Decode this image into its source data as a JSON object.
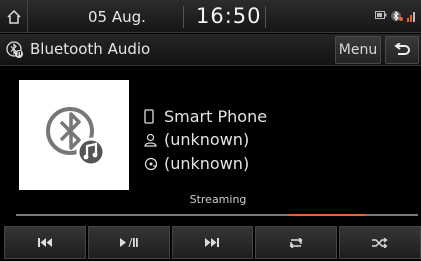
{
  "status": {
    "date": "05 Aug.",
    "time": "16:50",
    "icons": [
      "home-icon",
      "battery-icon",
      "bluetooth-status-icon",
      "signal-icon"
    ]
  },
  "titlebar": {
    "title": "Bluetooth Audio",
    "menu_label": "Menu",
    "back_icon": "back-icon"
  },
  "track": {
    "device": "Smart Phone",
    "artist": "(unknown)",
    "album": "(unknown)",
    "state": "Streaming"
  },
  "progress": {
    "bar_color": "#7a7a7a",
    "marker_color": "#e7642e",
    "marker_start": 0.68,
    "marker_end": 0.87
  },
  "controls": [
    "previous-icon",
    "play-pause-icon",
    "next-icon",
    "repeat-icon",
    "shuffle-icon"
  ],
  "colors": {
    "background": "#000000",
    "accent": "#e7642e"
  }
}
